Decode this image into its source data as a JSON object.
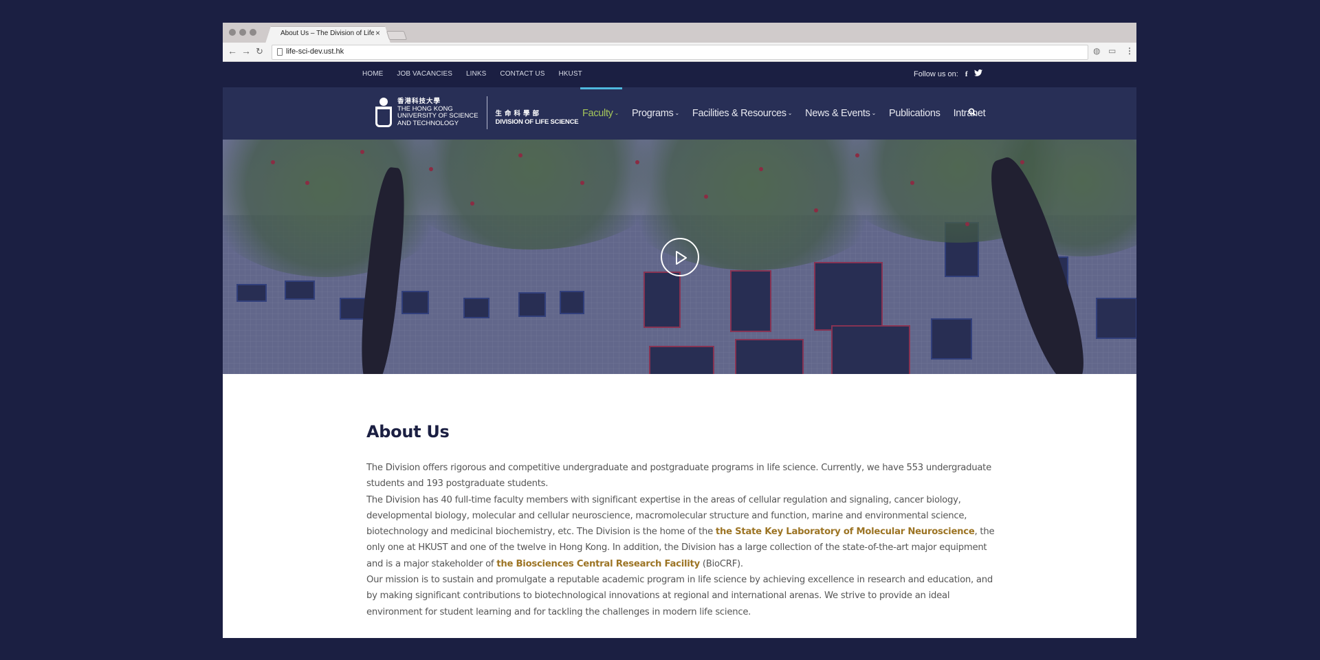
{
  "browser": {
    "tab_title": "About Us – The Division of Life Science",
    "url": "life-sci-dev.ust.hk",
    "nav": {
      "back_icon": "arrow-left-icon",
      "forward_icon": "arrow-right-icon",
      "reload_icon": "reload-icon"
    },
    "toolbar_icons": [
      "extension-icon",
      "cast-icon",
      "menu-kebab-icon"
    ]
  },
  "topbar": {
    "links": [
      "HOME",
      "JOB VACANCIES",
      "LINKS",
      "CONTACT US",
      "HKUST"
    ],
    "follow_label": "Follow us on:",
    "social": [
      {
        "name": "facebook-icon",
        "glyph": "f"
      },
      {
        "name": "twitter-icon",
        "glyph": "🐦"
      }
    ]
  },
  "logo": {
    "university_zh": "香港科技大學",
    "university_en_line1": "THE HONG KONG",
    "university_en_line2": "UNIVERSITY OF SCIENCE",
    "university_en_line3": "AND TECHNOLOGY",
    "division_zh": "生命科學部",
    "division_en": "DIVISION OF LIFE SCIENCE"
  },
  "menu": {
    "items": [
      {
        "label": "Faculty",
        "dropdown": true,
        "active": true
      },
      {
        "label": "Programs",
        "dropdown": true
      },
      {
        "label": "Facilities & Resources",
        "dropdown": true
      },
      {
        "label": "News & Events",
        "dropdown": true
      },
      {
        "label": "Publications",
        "dropdown": false
      },
      {
        "label": "Intranet",
        "dropdown": false
      }
    ],
    "chevron": "⌄",
    "active_color": "#a6c85a",
    "indicator_color": "#4fb8de"
  },
  "hero": {
    "play_label": "Play video"
  },
  "content": {
    "title": "About Us",
    "p1": "The Division offers rigorous and competitive undergraduate and postgraduate programs in life science. Currently, we have 553 undergraduate students and 193 postgraduate students.",
    "p2_a": "The Division has 40 full-time faculty members with significant expertise in the areas of cellular regulation and signaling, cancer biology, developmental biology, molecular and cellular neuroscience, macromolecular structure and function, marine and environmental science, biotechnology and medicinal biochemistry, etc. The Division is the home of the ",
    "p2_link1": "the State Key Laboratory of Molecular Neuroscience",
    "p2_b": ", the only one at HKUST and one of the twelve in Hong Kong. In addition, the Division has a large collection of the state-of-the-art major equipment and is a major stakeholder of ",
    "p2_link2": "the Biosciences Central Research Facility",
    "p2_c": " (BioCRF).",
    "p3": "Our mission is to sustain and promulgate a reputable academic program in life science by achieving excellence in research and education, and by making significant contributions to biotechnological innovations at regional and international arenas. We strive to provide an ideal environment for student learning and for tackling the challenges in modern life science.",
    "link_color": "#9c7424"
  }
}
